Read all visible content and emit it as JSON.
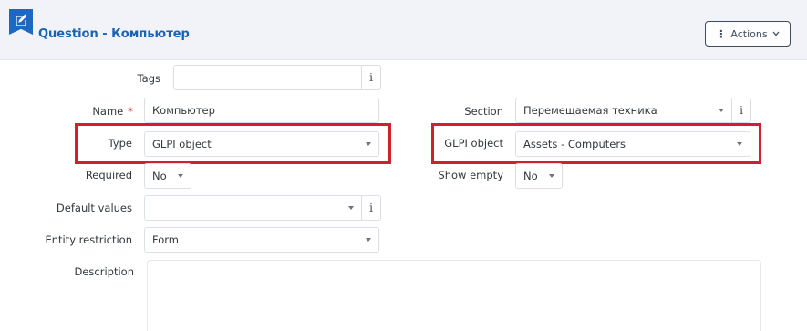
{
  "header": {
    "icon": "edit-icon",
    "title": "Question - Компьютер",
    "actions_label": "Actions"
  },
  "form": {
    "tags": {
      "label": "Tags",
      "value": ""
    },
    "name": {
      "label": "Name",
      "required_mark": "*",
      "value": "Компьютер"
    },
    "section": {
      "label": "Section",
      "value": "Перемещаемая техника"
    },
    "type": {
      "label": "Type",
      "value": "GLPI object"
    },
    "glpi_object": {
      "label": "GLPI object",
      "value": "Assets - Computers"
    },
    "required": {
      "label": "Required",
      "value": "No"
    },
    "show_empty": {
      "label": "Show empty",
      "value": "No"
    },
    "default_values": {
      "label": "Default values",
      "value": ""
    },
    "entity_restriction": {
      "label": "Entity restriction",
      "value": "Form"
    },
    "description": {
      "label": "Description",
      "value": ""
    }
  },
  "colors": {
    "accent": "#1f68c1",
    "highlight": "#d0202e",
    "required": "#d63939"
  }
}
